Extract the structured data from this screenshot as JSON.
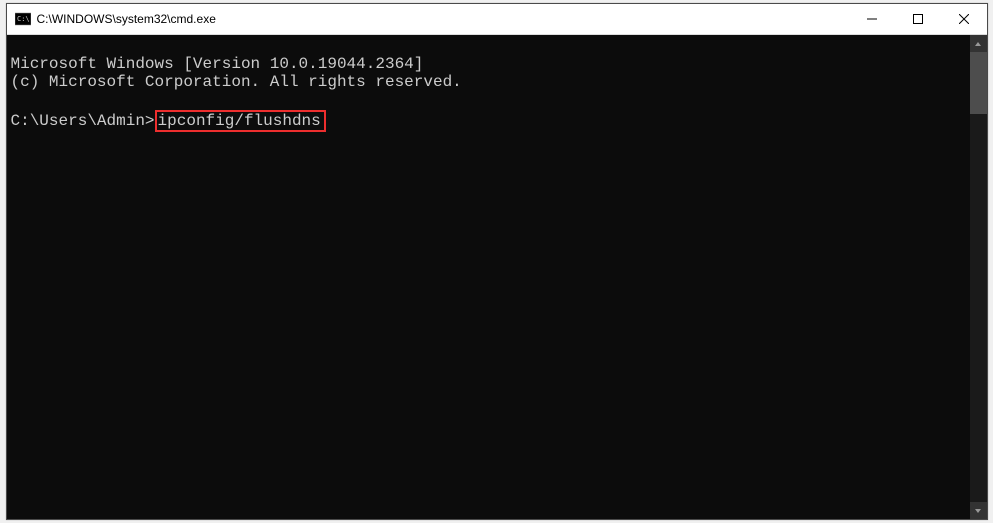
{
  "titlebar": {
    "title": "C:\\WINDOWS\\system32\\cmd.exe"
  },
  "console": {
    "line1": "Microsoft Windows [Version 10.0.19044.2364]",
    "line2": "(c) Microsoft Corporation. All rights reserved.",
    "prompt": "C:\\Users\\Admin>",
    "command": "ipconfig/flushdns"
  }
}
